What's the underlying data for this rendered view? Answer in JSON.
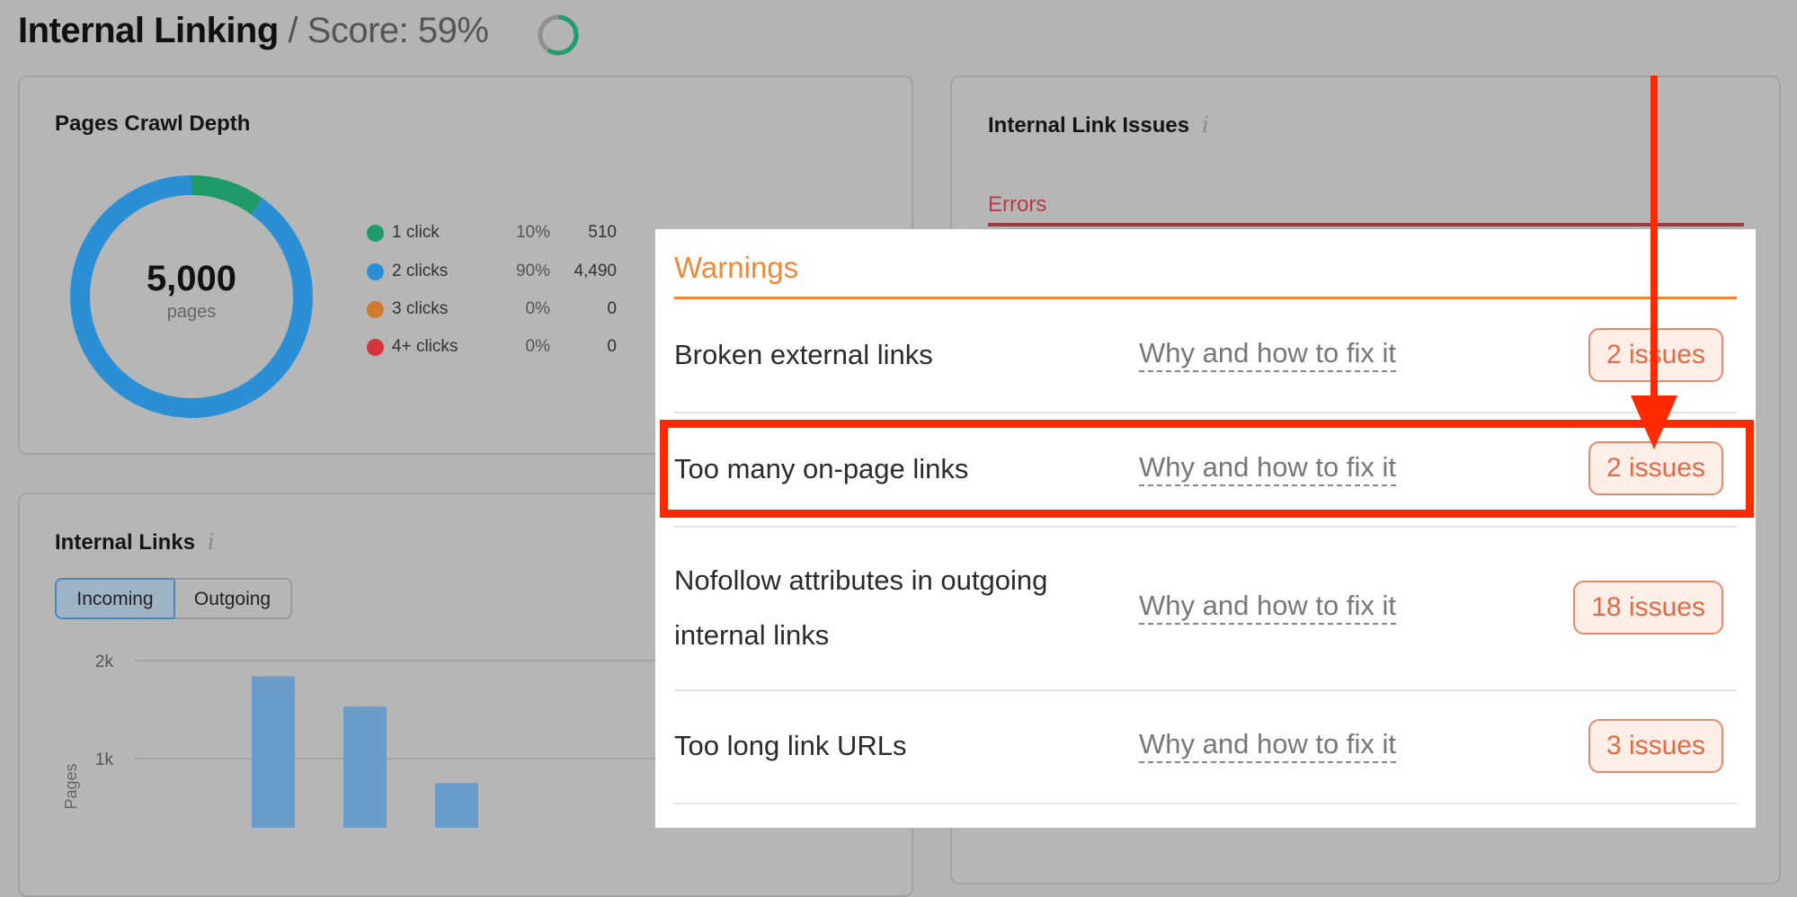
{
  "header": {
    "title": "Internal Linking",
    "score_label": "/ Score: 59%",
    "score_value": 59,
    "score_color": "#1f9e6e"
  },
  "crawl_depth": {
    "title": "Pages Crawl Depth",
    "total": "5,000",
    "total_unit": "pages",
    "items": [
      {
        "label": "1 click",
        "pct": "10%",
        "value": "510",
        "color": "#1e9b68",
        "share": 10
      },
      {
        "label": "2 clicks",
        "pct": "90%",
        "value": "4,490",
        "color": "#2b8fd6",
        "share": 90
      },
      {
        "label": "3 clicks",
        "pct": "0%",
        "value": "0",
        "color": "#d07a2b",
        "share": 0
      },
      {
        "label": "4+ clicks",
        "pct": "0%",
        "value": "0",
        "color": "#d6353d",
        "share": 0
      }
    ]
  },
  "issues_card": {
    "title": "Internal Link Issues",
    "errors_label": "Errors",
    "errors_color": "#c7323d"
  },
  "internal_links": {
    "title": "Internal Links",
    "tabs": [
      {
        "label": "Incoming",
        "active": true
      },
      {
        "label": "Outgoing",
        "active": false
      }
    ],
    "chart_data": {
      "type": "bar",
      "ylabel": "Pages",
      "yticks": [
        "1k",
        "2k"
      ],
      "values": [
        1840,
        1530,
        750
      ],
      "ylim": [
        0,
        2000
      ],
      "color": "#6a9cc9"
    }
  },
  "warnings": {
    "title": "Warnings",
    "accent": "#f0883a",
    "rows": [
      {
        "label": "Broken external links",
        "link": "Why and how to fix it",
        "badge": "2 issues"
      },
      {
        "label": "Too many on-page links",
        "link": "Why and how to fix it",
        "badge": "2 issues",
        "highlighted": true
      },
      {
        "label": "Nofollow attributes in outgoing",
        "label2": "internal links",
        "link": "Why and how to fix it",
        "badge": "18 issues"
      },
      {
        "label": "Too long link URLs",
        "link": "Why and how to fix it",
        "badge": "3 issues"
      }
    ]
  },
  "annotation": {
    "color": "#ff2a00"
  }
}
